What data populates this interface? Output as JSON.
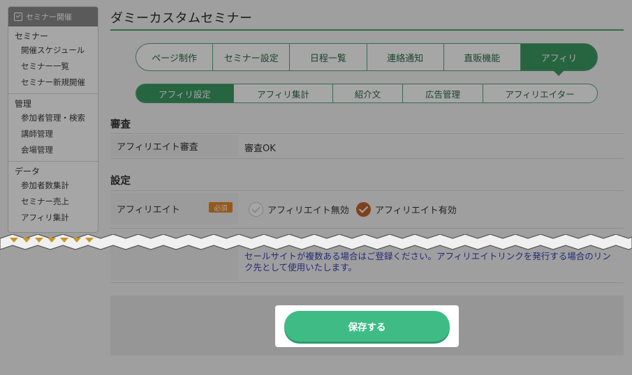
{
  "sidebar": {
    "header": "セミナー開催",
    "sections": [
      {
        "title": "セミナー",
        "items": [
          "開催スケジュール",
          "セミナー一覧",
          "セミナー新規開催"
        ]
      },
      {
        "title": "管理",
        "items": [
          "参加者管理・検索",
          "講師管理",
          "会場管理"
        ]
      },
      {
        "title": "データ",
        "items": [
          "参加者数集計",
          "セミナー売上",
          "アフィリ集計"
        ]
      }
    ]
  },
  "page": {
    "title": "ダミーカスタムセミナー"
  },
  "tabs_main": [
    "ページ制作",
    "セミナー設定",
    "日程一覧",
    "連絡通知",
    "直販機能",
    "アフィリ"
  ],
  "tabs_sub": [
    "アフィリ設定",
    "アフィリ集計",
    "紹介文",
    "広告管理",
    "アフィリエイター"
  ],
  "review": {
    "heading": "審査",
    "label": "アフィリエイト審査",
    "value": "審査OK"
  },
  "settings": {
    "heading": "設定",
    "label": "アフィリエイト",
    "required": "必須",
    "option_off": "アフィリエイト無効",
    "option_on": "アフィリエイト有効",
    "note": "セールサイトが複数ある場合はご登録ください。アフィリエイトリンクを発行する場合のリンク先として使用いたします。"
  },
  "save_label": "保存する",
  "colors": {
    "brand": "#3d9a63",
    "save": "#3fbc86",
    "badge": "#e38a2d",
    "check_on": "#c0652a"
  }
}
